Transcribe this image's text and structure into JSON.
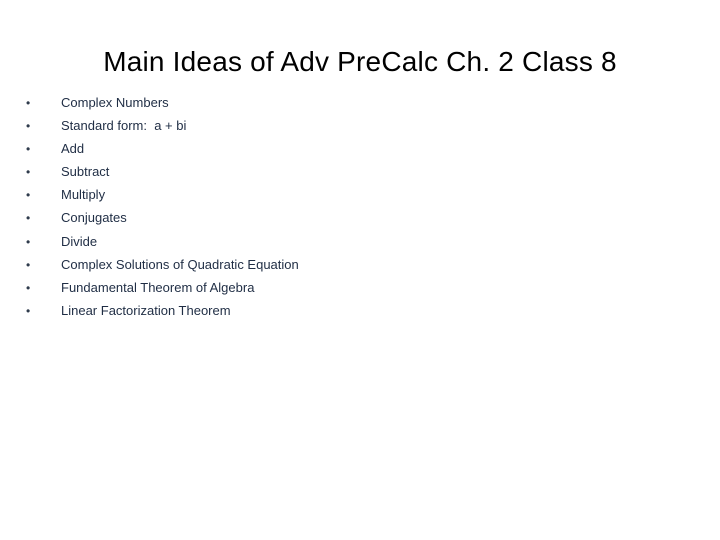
{
  "slide": {
    "title": "Main Ideas of Adv PreCalc Ch. 2 Class 8",
    "bullet_glyph": "•",
    "items": [
      "Complex Numbers",
      "Standard form:  a + bi",
      "Add",
      "Subtract",
      "Multiply",
      "Conjugates",
      "Divide",
      "Complex Solutions of Quadratic Equation",
      "Fundamental Theorem of Algebra",
      "Linear Factorization Theorem"
    ]
  }
}
